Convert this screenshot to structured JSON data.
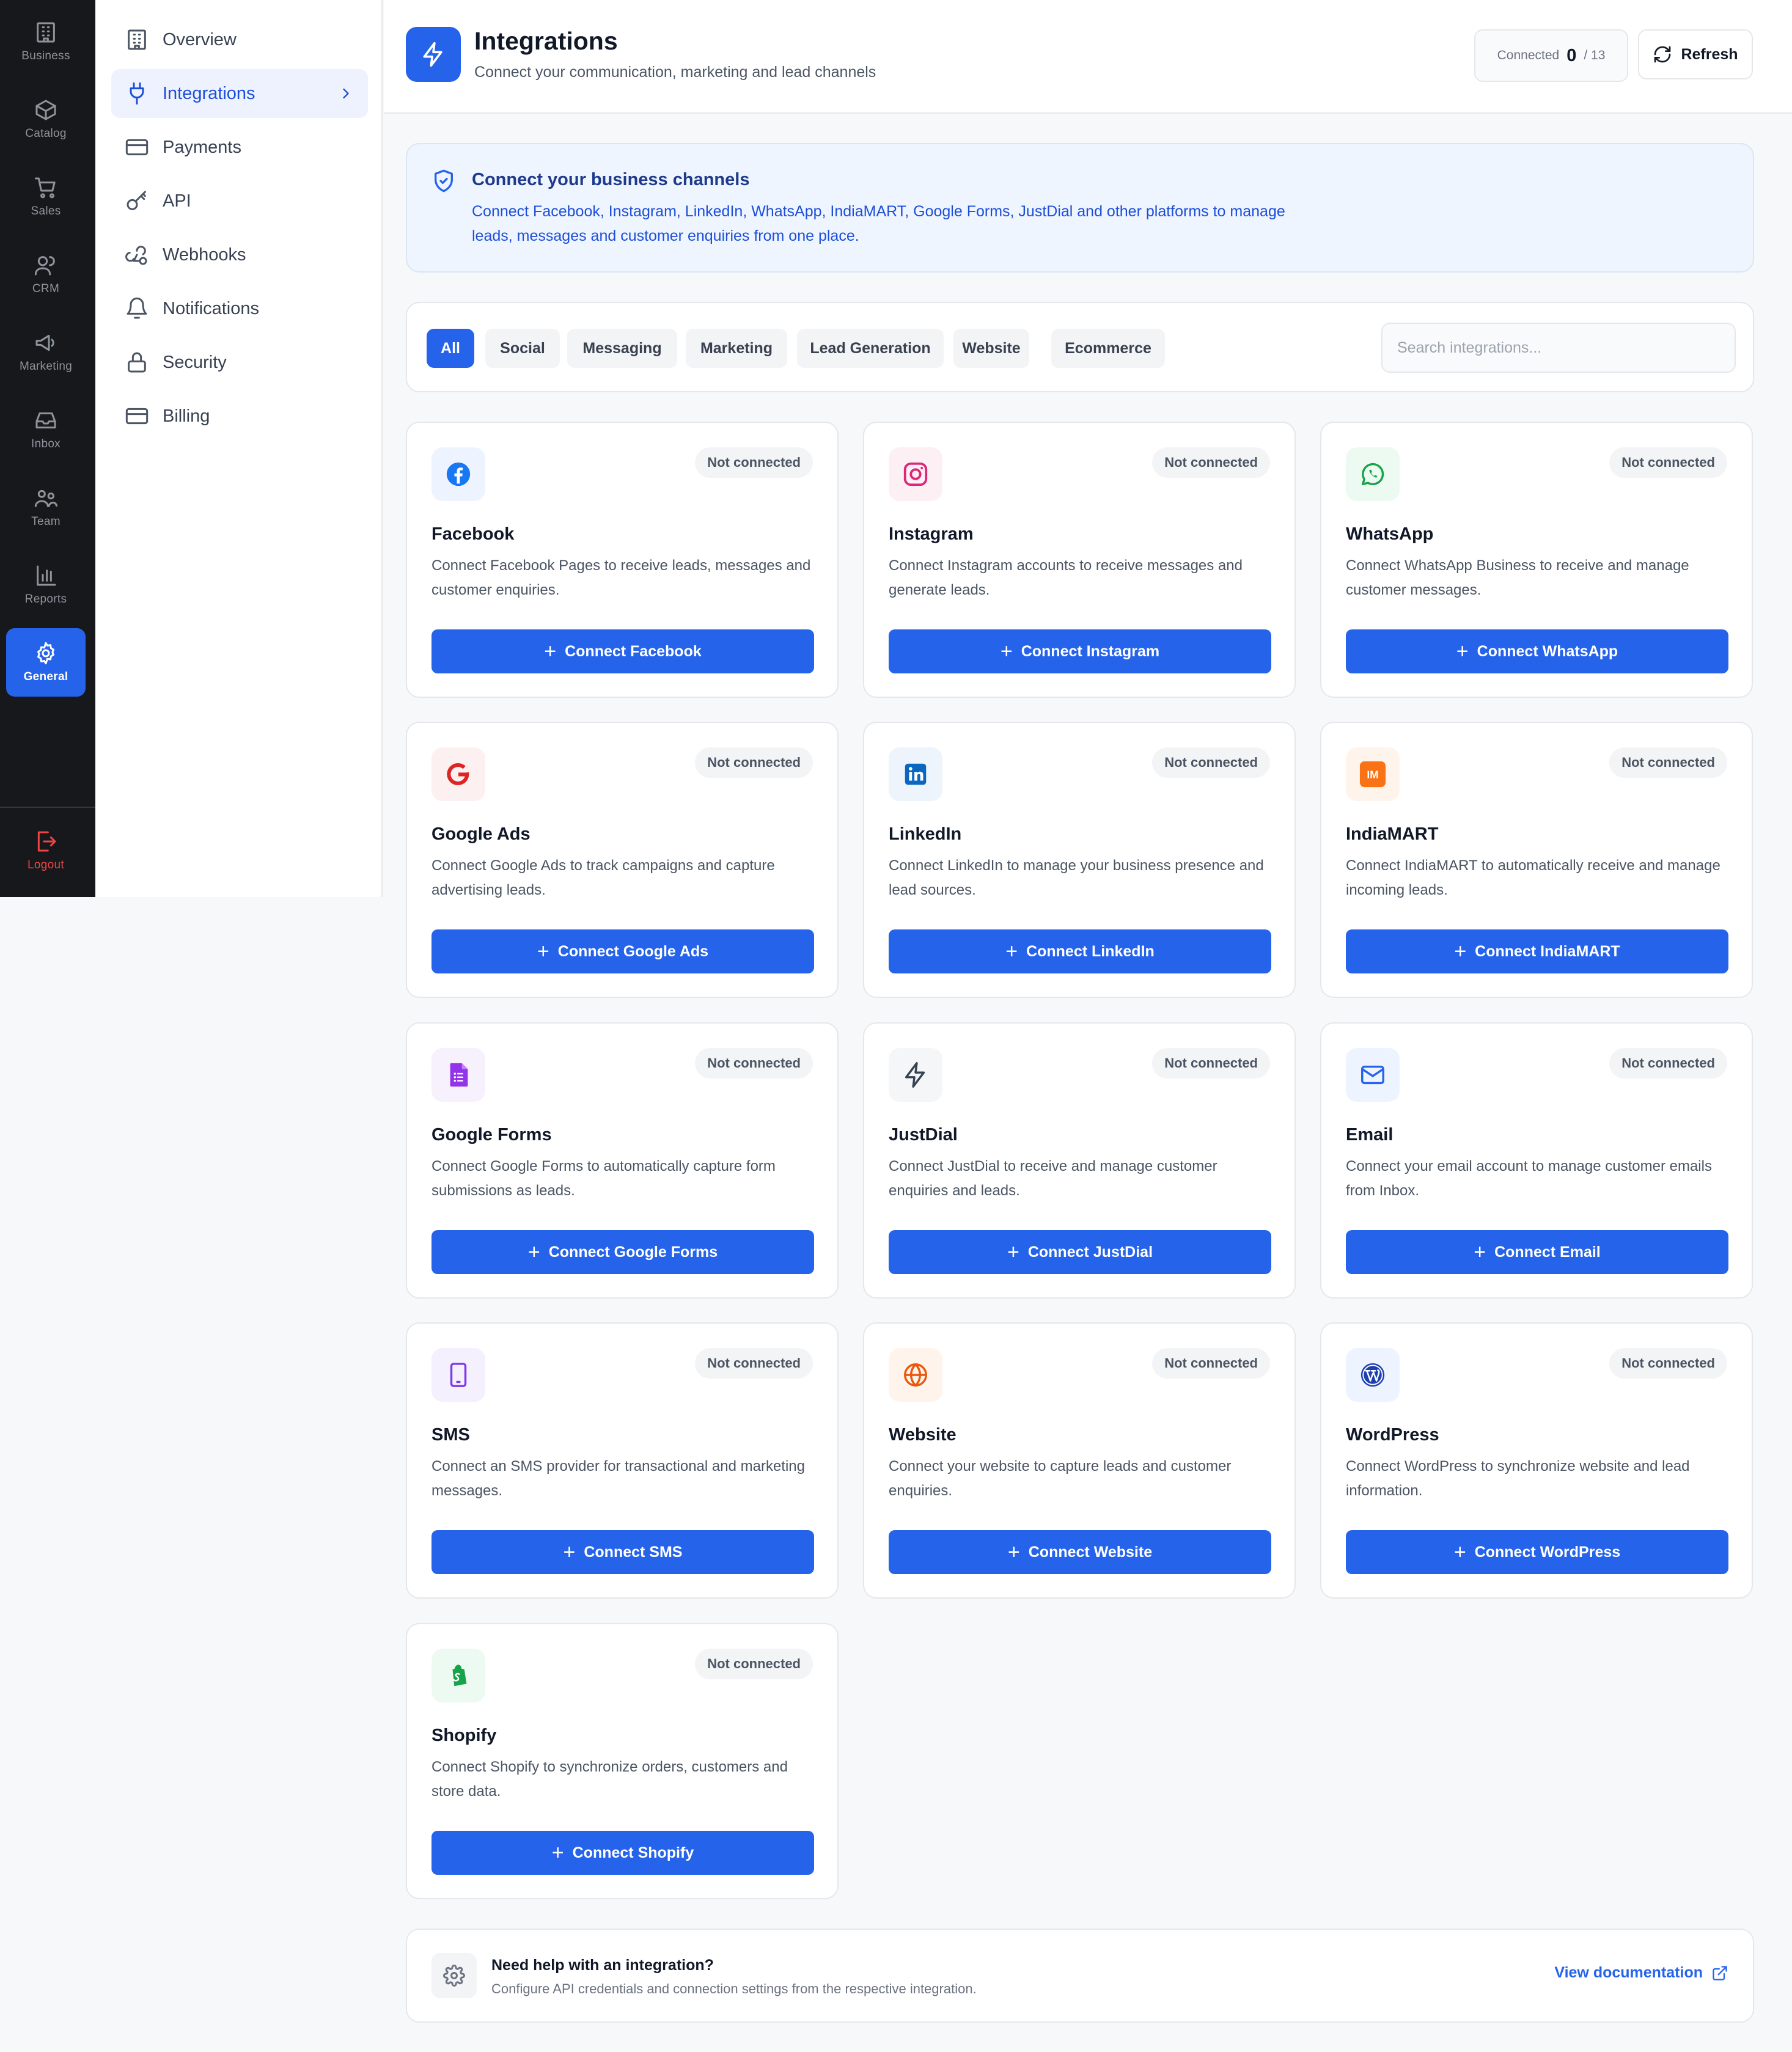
{
  "rail": {
    "items": [
      {
        "label": "Business",
        "icon": "building-icon"
      },
      {
        "label": "Catalog",
        "icon": "box-icon"
      },
      {
        "label": "Sales",
        "icon": "cart-icon"
      },
      {
        "label": "CRM",
        "icon": "users-icon"
      },
      {
        "label": "Marketing",
        "icon": "megaphone-icon"
      },
      {
        "label": "Inbox",
        "icon": "inbox-icon"
      },
      {
        "label": "Team",
        "icon": "team-icon"
      },
      {
        "label": "Reports",
        "icon": "bar-chart-icon"
      },
      {
        "label": "General",
        "icon": "gear-icon",
        "active": true
      }
    ],
    "logout": "Logout"
  },
  "sidebar": {
    "items": [
      {
        "label": "Overview",
        "icon": "building-icon"
      },
      {
        "label": "Integrations",
        "icon": "plug-icon",
        "active": true
      },
      {
        "label": "Payments",
        "icon": "card-icon"
      },
      {
        "label": "API",
        "icon": "key-icon"
      },
      {
        "label": "Webhooks",
        "icon": "webhook-icon"
      },
      {
        "label": "Notifications",
        "icon": "bell-icon"
      },
      {
        "label": "Security",
        "icon": "lock-icon"
      },
      {
        "label": "Billing",
        "icon": "card-icon"
      }
    ]
  },
  "header": {
    "title": "Integrations",
    "subtitle": "Connect your communication, marketing and lead channels",
    "connected_label": "Connected",
    "connected_count": "0",
    "connected_total": "/ 13",
    "refresh_label": "Refresh"
  },
  "banner": {
    "title": "Connect your business channels",
    "description": "Connect Facebook, Instagram, LinkedIn, WhatsApp, IndiaMART, Google Forms, JustDial and other platforms to manage leads, messages and customer enquiries from one place."
  },
  "filters": {
    "chips": [
      "All",
      "Social",
      "Messaging",
      "Marketing",
      "Lead Generation",
      "Website",
      "Ecommerce"
    ],
    "active": "All",
    "search_placeholder": "Search integrations..."
  },
  "status_label": "Not connected",
  "integrations": [
    {
      "name": "Facebook",
      "description": "Connect Facebook Pages to receive leads, messages and customer enquiries.",
      "button": "Connect Facebook",
      "icon": "facebook-icon",
      "color": "#1877f2",
      "bg": "#eef4ff"
    },
    {
      "name": "Instagram",
      "description": "Connect Instagram accounts to receive messages and generate leads.",
      "button": "Connect Instagram",
      "icon": "instagram-icon",
      "color": "#db2777",
      "bg": "#fdf0f5"
    },
    {
      "name": "WhatsApp",
      "description": "Connect WhatsApp Business to receive and manage customer messages.",
      "button": "Connect WhatsApp",
      "icon": "whatsapp-icon",
      "color": "#16a34a",
      "bg": "#edfaf2"
    },
    {
      "name": "Google Ads",
      "description": "Connect Google Ads to track campaigns and capture advertising leads.",
      "button": "Connect Google Ads",
      "icon": "google-icon",
      "color": "#dc2626",
      "bg": "#fdf0f0"
    },
    {
      "name": "LinkedIn",
      "description": "Connect LinkedIn to manage your business presence and lead sources.",
      "button": "Connect LinkedIn",
      "icon": "linkedin-icon",
      "color": "#0a66c2",
      "bg": "#eef4fb"
    },
    {
      "name": "IndiaMART",
      "description": "Connect IndiaMART to automatically receive and manage incoming leads.",
      "button": "Connect IndiaMART",
      "icon": "indiamart-icon",
      "logo_text": "IM",
      "color": "#f97316",
      "bg": "#fff4ec"
    },
    {
      "name": "Google Forms",
      "description": "Connect Google Forms to automatically capture form submissions as leads.",
      "button": "Connect Google Forms",
      "icon": "google-forms-icon",
      "color": "#9333ea",
      "bg": "#f7f0fd"
    },
    {
      "name": "JustDial",
      "description": "Connect JustDial to receive and manage customer enquiries and leads.",
      "button": "Connect JustDial",
      "icon": "lightning-icon",
      "color": "#374151",
      "bg": "#f5f6f8"
    },
    {
      "name": "Email",
      "description": "Connect your email account to manage customer emails from Inbox.",
      "button": "Connect Email",
      "icon": "mail-icon",
      "color": "#2563eb",
      "bg": "#eef4ff"
    },
    {
      "name": "SMS",
      "description": "Connect an SMS provider for transactional and marketing messages.",
      "button": "Connect SMS",
      "icon": "phone-icon",
      "color": "#7c3aed",
      "bg": "#f4f0fd"
    },
    {
      "name": "Website",
      "description": "Connect your website to capture leads and customer enquiries.",
      "button": "Connect Website",
      "icon": "globe-icon",
      "color": "#ea580c",
      "bg": "#fff4ec"
    },
    {
      "name": "WordPress",
      "description": "Connect WordPress to synchronize website and lead information.",
      "button": "Connect WordPress",
      "icon": "wordpress-icon",
      "color": "#1e40af",
      "bg": "#eef4ff"
    },
    {
      "name": "Shopify",
      "description": "Connect Shopify to synchronize orders, customers and store data.",
      "button": "Connect Shopify",
      "icon": "shopify-icon",
      "color": "#16a34a",
      "bg": "#edfaf2"
    }
  ],
  "help": {
    "title": "Need help with an integration?",
    "description": "Configure API credentials and connection settings from the respective integration.",
    "link": "View documentation"
  },
  "colors": {
    "accent": "#2563eb",
    "rail_bg": "#17181b",
    "logout": "#ef4444"
  }
}
